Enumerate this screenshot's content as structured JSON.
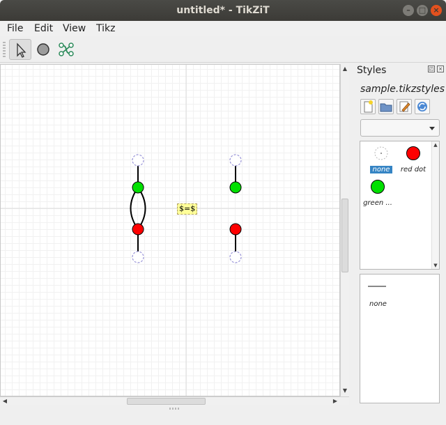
{
  "window": {
    "title": "untitled* - TikZiT",
    "minimize_glyph": "–",
    "maximize_glyph": "□",
    "close_glyph": "×"
  },
  "menu": [
    "File",
    "Edit",
    "View",
    "Tikz"
  ],
  "toolbar": {
    "tools": [
      {
        "name": "select-tool",
        "icon": "pointer-arrow-icon",
        "active": true
      },
      {
        "name": "node-tool",
        "icon": "circle-icon",
        "active": false
      },
      {
        "name": "edge-tool",
        "icon": "edge-icon",
        "active": false
      }
    ]
  },
  "canvas": {
    "label_text": "$=$",
    "node_colors": {
      "red": "#ff0000",
      "green": "#00dd00",
      "none": "#9a95d8"
    }
  },
  "styles_panel": {
    "title": "Styles",
    "file": "sample.tikzstyles",
    "node_styles": [
      {
        "label": "none",
        "selected": true
      },
      {
        "label": "red dot",
        "selected": false
      },
      {
        "label": "green ...",
        "selected": false
      }
    ],
    "edge_styles": [
      {
        "label": "none"
      }
    ]
  }
}
